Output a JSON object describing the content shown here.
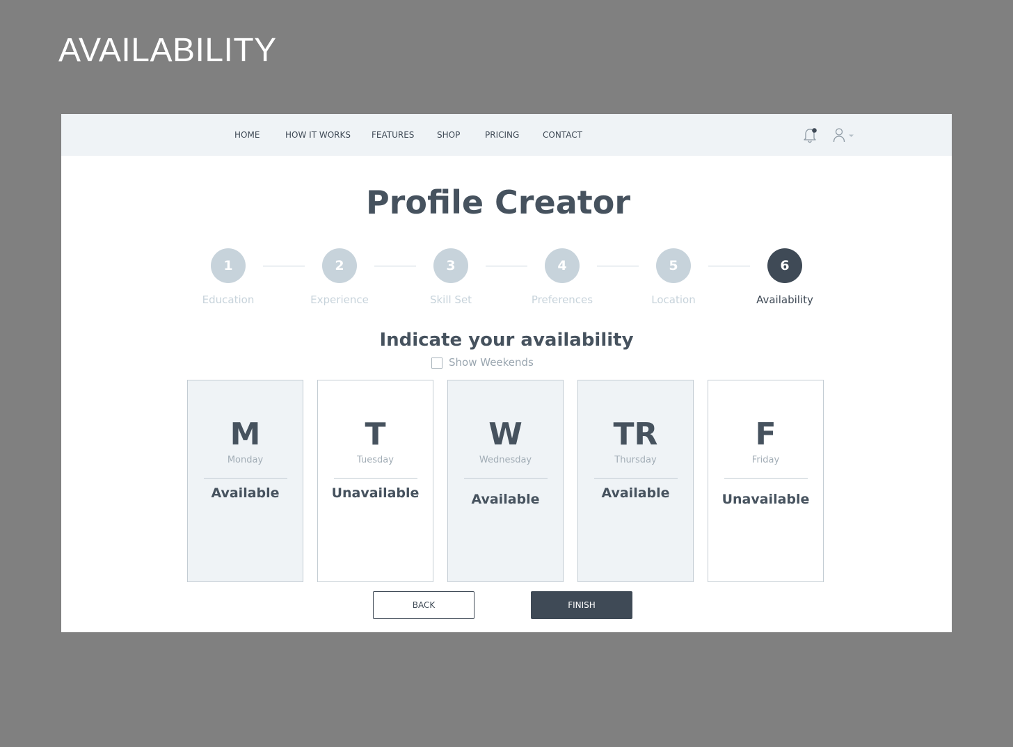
{
  "board": {
    "title": "AVAILABILITY"
  },
  "nav": {
    "items": [
      {
        "label": "HOME"
      },
      {
        "label": "HOW IT WORKS"
      },
      {
        "label": "FEATURES"
      },
      {
        "label": "SHOP"
      },
      {
        "label": "PRICING"
      },
      {
        "label": "CONTACT"
      }
    ],
    "icons": {
      "notifications": "bell-icon",
      "user": "user-icon",
      "dropdown": "chevron-down-icon"
    }
  },
  "page": {
    "title": "Profile Creator"
  },
  "stepper": {
    "steps": [
      {
        "number": "1",
        "label": "Education",
        "state": "inactive"
      },
      {
        "number": "2",
        "label": "Experience",
        "state": "inactive"
      },
      {
        "number": "3",
        "label": "Skill Set",
        "state": "inactive"
      },
      {
        "number": "4",
        "label": "Preferences",
        "state": "inactive"
      },
      {
        "number": "5",
        "label": "Location",
        "state": "inactive"
      },
      {
        "number": "6",
        "label": "Availability",
        "state": "active"
      }
    ]
  },
  "availability": {
    "heading": "Indicate your availability",
    "show_weekends": {
      "label": "Show Weekends",
      "checked": false
    },
    "days": [
      {
        "letter": "M",
        "name": "Monday",
        "status": "Available"
      },
      {
        "letter": "T",
        "name": "Tuesday",
        "status": "Unavailable"
      },
      {
        "letter": "W",
        "name": "Wednesday",
        "status": "Available"
      },
      {
        "letter": "TR",
        "name": "Thursday",
        "status": "Available"
      },
      {
        "letter": "F",
        "name": "Friday",
        "status": "Unavailable"
      }
    ]
  },
  "actions": {
    "back_label": "BACK",
    "finish_label": "FINISH"
  },
  "colors": {
    "background": "#808080",
    "nav_background": "#eff3f6",
    "primary_dark": "#3f4a56",
    "heading_text": "#46525e",
    "inactive_step": "#c7d3db",
    "available_card": "#eff3f6",
    "unavailable_card": "#ffffff"
  }
}
